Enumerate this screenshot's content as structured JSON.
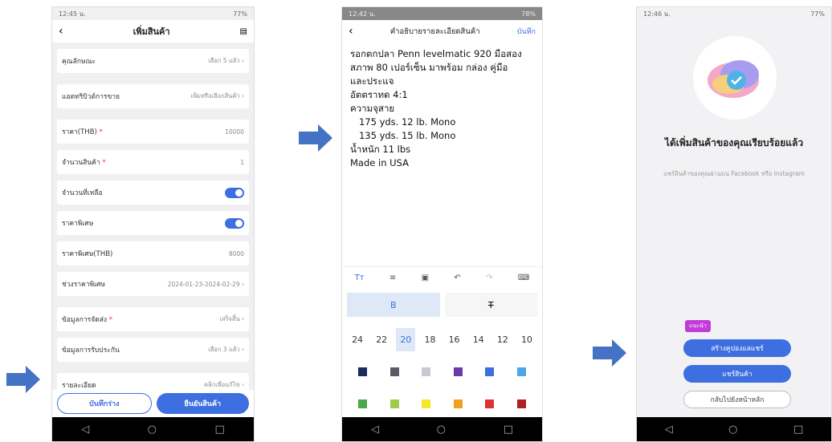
{
  "phone1": {
    "status": {
      "time": "12:45 น.",
      "battery": "77%"
    },
    "title": "เพิ่มสินค้า",
    "rows": [
      {
        "label": "คุณลักษณะ",
        "value": "เลือก 5 แล้ว"
      },
      {
        "label": "แอตทริบิวต์การขาย",
        "value": "เพิ่มหรือเลือกสินค้า"
      },
      {
        "label": "ราคา(THB)",
        "value": "10000"
      },
      {
        "label": "จำนวนสินค้า",
        "value": "1"
      },
      {
        "label": "จำนวนที่เหลือ",
        "value": ""
      },
      {
        "label": "ราคาพิเศษ",
        "value": ""
      },
      {
        "label": "ราคาพิเศษ(THB)",
        "value": "8000"
      },
      {
        "label": "ช่วงราคาพิเศษ",
        "value": "2024-01-23-2024-02-29"
      },
      {
        "label": "ข้อมูลการจัดส่ง",
        "value": "เสร็จสิ้น"
      },
      {
        "label": "ข้อมูลการรับประกัน",
        "value": "เลือก 3 แล้ว"
      },
      {
        "label": "รายละเอียด",
        "value": "คลิกเพื่อแก้ไข"
      }
    ],
    "required_mark": "*",
    "draft_button": "บันทึกร่าง",
    "confirm_button": "ยืนยันสินค้า"
  },
  "phone2": {
    "status": {
      "time": "12:42 น.",
      "battery": "78%"
    },
    "title": "คำอธิบายรายละเอียดสินค้า",
    "save": "บันทึก",
    "lines": [
      "รอกตกปลา Penn levelmatic 920 มือสอง",
      "สภาพ 80 เปอร์เซ็น มาพร้อม กล่อง คู่มือ",
      "และประแจ",
      "อัตตราทด 4:1",
      "ความจุสาย",
      "   175 yds. 12 lb. Mono",
      "   135 yds. 15 lb. Mono",
      "น้ำหนัก 11 lbs",
      "Made in USA"
    ],
    "bold_label": "B",
    "strike_label": "T",
    "sizes": [
      "24",
      "22",
      "20",
      "18",
      "16",
      "14",
      "12",
      "10"
    ],
    "selected_size": "20",
    "colors_row1": [
      "#1c2a5c",
      "#5a5a66",
      "#c8c8d0",
      "#6a3aa8",
      "#3d6fe0",
      "#4aa8e8"
    ],
    "colors_row2": [
      "#4aa84a",
      "#9ccc4a",
      "#f5e62a",
      "#f0a020",
      "#e03030",
      "#b02020"
    ]
  },
  "phone3": {
    "status": {
      "time": "12:46 น.",
      "battery": "77%"
    },
    "done_title": "ได้เพิ่มสินค้าของคุณเรียบร้อยแล้ว",
    "share_text": "แชร์สินค้าของคุณผ่านบน Facebook หรือ Instagram",
    "tag": "แนะนำ",
    "coupon_button": "สร้างคูปองแลแชร์",
    "share_button": "แชร์สินค้า",
    "home_button": "กลับไปยังหน้าหลัก"
  },
  "nav": {
    "back": "◁",
    "home": "○",
    "recent": "□"
  }
}
